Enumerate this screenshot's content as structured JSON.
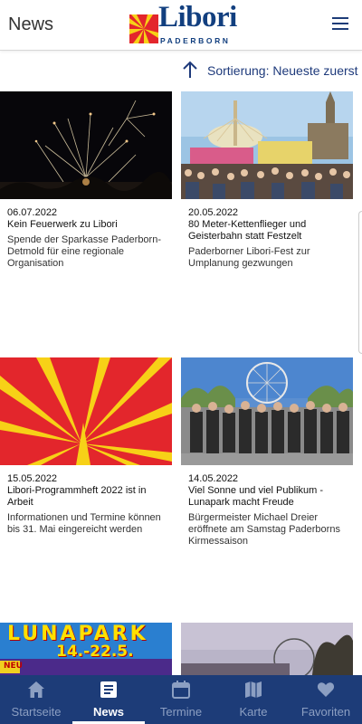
{
  "header": {
    "title": "News",
    "logo_word": "Libori",
    "logo_sub": "PADERBORN"
  },
  "sort": {
    "label": "Sortierung: Neueste zuerst"
  },
  "articles": [
    {
      "date": "06.07.2022",
      "title": "Kein Feuerwerk zu Libori",
      "teaser": "Spende der Sparkasse Paderborn-Detmold für eine regionale Organisation"
    },
    {
      "date": "20.05.2022",
      "title": "80 Meter-Kettenflieger und Geisterbahn statt Festzelt",
      "teaser": "Paderborner Libori-Fest zur Umplanung gezwungen"
    },
    {
      "date": "15.05.2022",
      "title": "Libori-Programmheft 2022 ist in Arbeit",
      "teaser": "Informationen und Termine können bis 31. Mai eingereicht werden"
    },
    {
      "date": "14.05.2022",
      "title": "Viel Sonne und viel Publikum - Lunapark macht Freude",
      "teaser": "Bürgermeister Michael Dreier eröffnete am Samstag Paderborns Kirmessaison"
    },
    {
      "poster_title": "LUNAPARK",
      "poster_dates": "14.-22.5.",
      "poster_badge": "NEU"
    },
    {}
  ],
  "tabs": [
    {
      "label": "Startseite",
      "icon": "home-icon"
    },
    {
      "label": "News",
      "icon": "news-icon"
    },
    {
      "label": "Termine",
      "icon": "calendar-icon"
    },
    {
      "label": "Karte",
      "icon": "map-icon"
    },
    {
      "label": "Favoriten",
      "icon": "heart-icon"
    }
  ],
  "colors": {
    "brand_blue": "#1d3c78",
    "logo_red": "#e3262c",
    "logo_yellow": "#f7d117",
    "active_tab": "#ffffff",
    "inactive_tab": "#8c9fc2"
  }
}
